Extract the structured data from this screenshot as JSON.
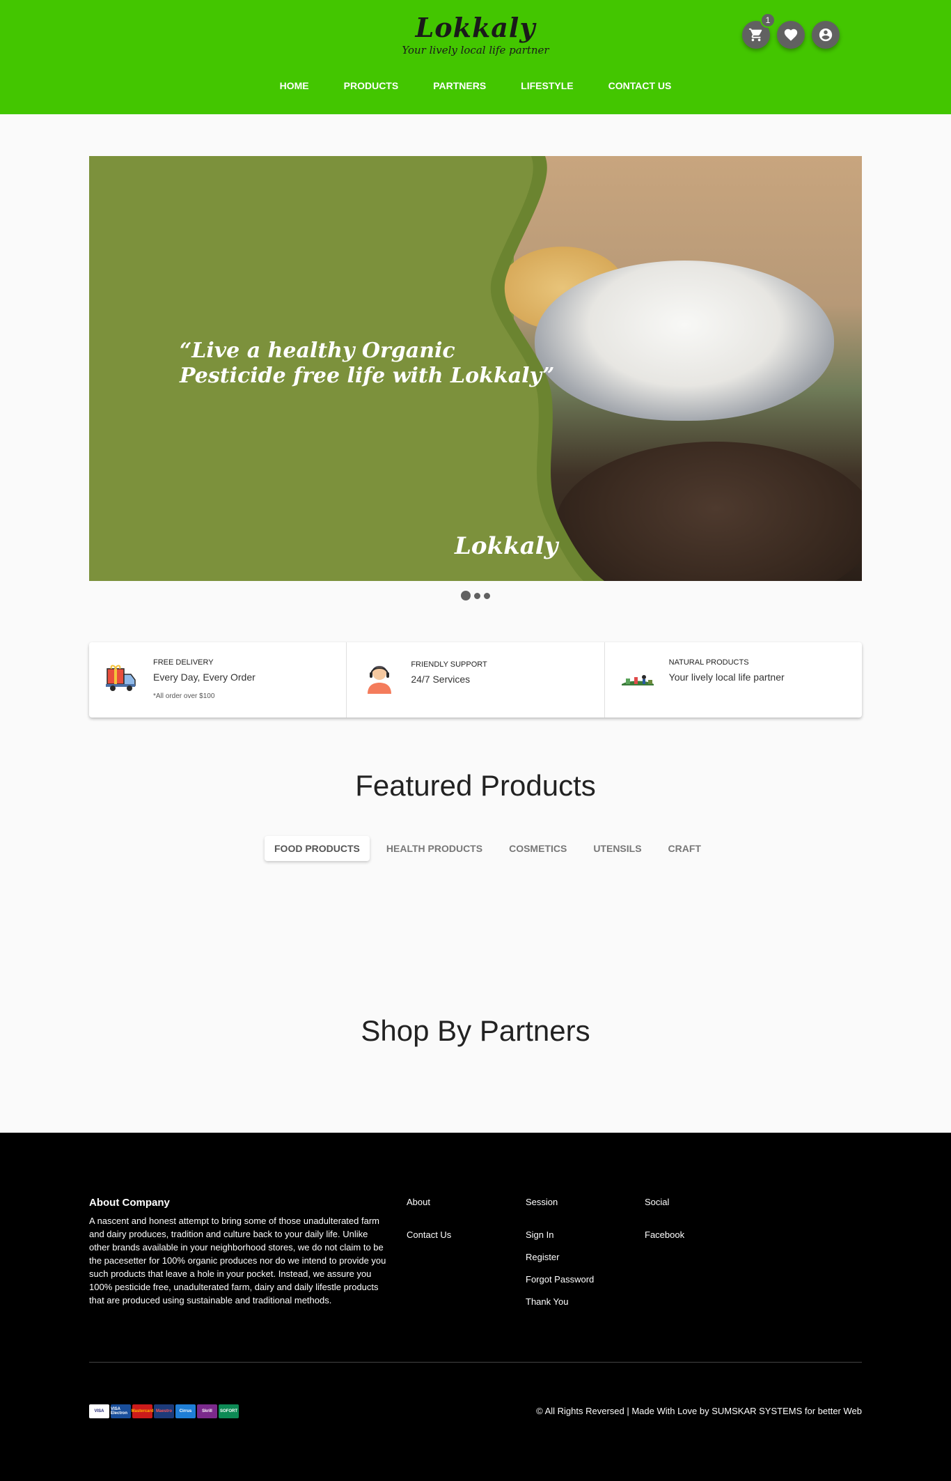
{
  "header": {
    "logo_title": "Lokkaly",
    "logo_tagline": "Your lively local life partner",
    "cart_count": "1",
    "nav": [
      "HOME",
      "PRODUCTS",
      "PARTNERS",
      "LIFESTYLE",
      "CONTACT US"
    ],
    "icons": [
      "cart-icon",
      "heart-icon",
      "account-icon"
    ]
  },
  "hero": {
    "quote_line1": "“Live a healthy Organic",
    "quote_line2": "Pesticide free life with Lokkaly”",
    "brand": "Lokkaly",
    "slides": 3,
    "active_slide": 1
  },
  "features": [
    {
      "kicker": "FREE DELIVERY",
      "value": "Every Day, Every Order",
      "note": "*All order over $100"
    },
    {
      "kicker": "FRIENDLY SUPPORT",
      "value": "24/7 Services",
      "note": ""
    },
    {
      "kicker": "NATURAL PRODUCTS",
      "value": "Your lively local life partner",
      "note": ""
    }
  ],
  "featured": {
    "title": "Featured Products",
    "tabs": [
      "FOOD PRODUCTS",
      "HEALTH PRODUCTS",
      "COSMETICS",
      "UTENSILS",
      "CRAFT"
    ],
    "active_tab": 0
  },
  "partners": {
    "title": "Shop By Partners"
  },
  "footer": {
    "about_title": "About Company",
    "about_text": "A nascent and honest attempt to bring some of those unadulterated farm and dairy produces, tradition and culture back to your daily life. Unlike other brands available in your neighborhood stores, we do not claim to be the pacesetter for 100% organic produces nor do we intend to provide you such products that leave a hole in your pocket. Instead, we assure you 100% pesticide free, unadulterated farm, dairy and daily lifestle products that are produced using sustainable and traditional methods.",
    "columns": [
      {
        "title": "About",
        "links": [
          "Contact Us"
        ]
      },
      {
        "title": "Session",
        "links": [
          "Sign In",
          "Register",
          "Forgot Password",
          "Thank You"
        ]
      },
      {
        "title": "Social",
        "links": [
          "Facebook"
        ]
      }
    ],
    "payment_cards": [
      "VISA",
      "VISA Electron",
      "Mastercard",
      "Maestro",
      "Cirrus",
      "Skrill",
      "SOFORT"
    ],
    "copyright": "© All Rights Reversed | Made With Love by SUMSKAR SYSTEMS for better Web"
  },
  "colors": {
    "header_bg": "#43c600",
    "hero_bg": "#7c913c",
    "footer_bg": "#000000",
    "icon_btn": "#616161"
  }
}
